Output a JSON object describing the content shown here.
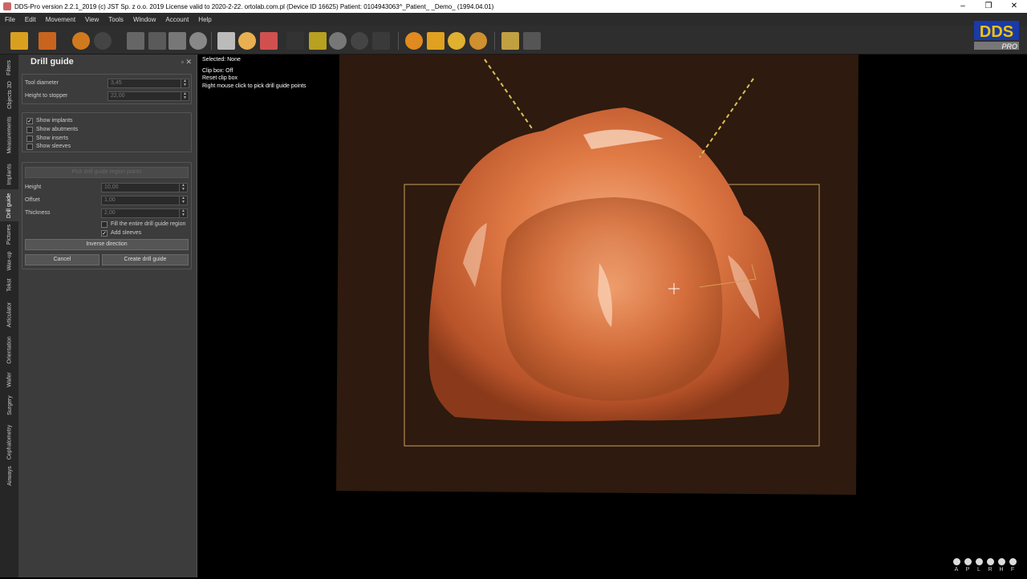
{
  "window": {
    "title": "DDS-Pro version 2.2.1_2019 (c) JST Sp. z o.o. 2019 License valid to 2020-2-22. ortolab.com.pl (Device ID 16625) Patient: 0104943063^_Patient_ _Demo_ (1994.04.01)",
    "minimize": "–",
    "maximize": "❐",
    "close": "✕"
  },
  "menu": [
    "File",
    "Edit",
    "Movement",
    "View",
    "Tools",
    "Window",
    "Account",
    "Help"
  ],
  "left_tabs": [
    "Filters",
    "Objects 3D",
    "Measurements",
    "Implants",
    "Drill guide",
    "Pictures",
    "Wax-up",
    "Tekst",
    "Articulator",
    "Orientation",
    "Wafer",
    "Surgery",
    "Cephalometry",
    "Airways"
  ],
  "active_tab": "Drill guide",
  "panel": {
    "title": "Drill guide",
    "tool_diameter_label": "Tool diameter",
    "tool_diameter_value": "3,45",
    "height_to_stopper_label": "Height to stopper",
    "height_to_stopper_value": "22,00",
    "show_implants": "Show implants",
    "show_abutments": "Show abutments",
    "show_inserts": "Show inserts",
    "show_sleeves": "Show sleeves",
    "pick_points_button": "Pick drill guide region points",
    "height_label": "Height",
    "height_value": "10,00",
    "offset_label": "Offset",
    "offset_value": "1,00",
    "thickness_label": "Thickness",
    "thickness_value": "2,00",
    "fill_region": "Fill the entire drill guide region",
    "add_sleeves": "Add sleeves",
    "inverse_button": "Inverse direction",
    "cancel_button": "Cancel",
    "create_button": "Create drill guide",
    "check": "✓"
  },
  "viewport": {
    "selected": "Selected: None",
    "clip_box": "Clip box: Off",
    "reset_clip": "Reset clip box",
    "hint": "Right mouse click to pick drill guide points"
  },
  "logo": {
    "text": "DDS",
    "sub": "PRO"
  },
  "view_cube": [
    "A",
    "P",
    "L",
    "R",
    "H",
    "F"
  ],
  "colors": {
    "model": "#e07a45",
    "guide_lines": "#d9c05a",
    "plate": "#2e1a0e",
    "clip_box": "#c9a060"
  }
}
